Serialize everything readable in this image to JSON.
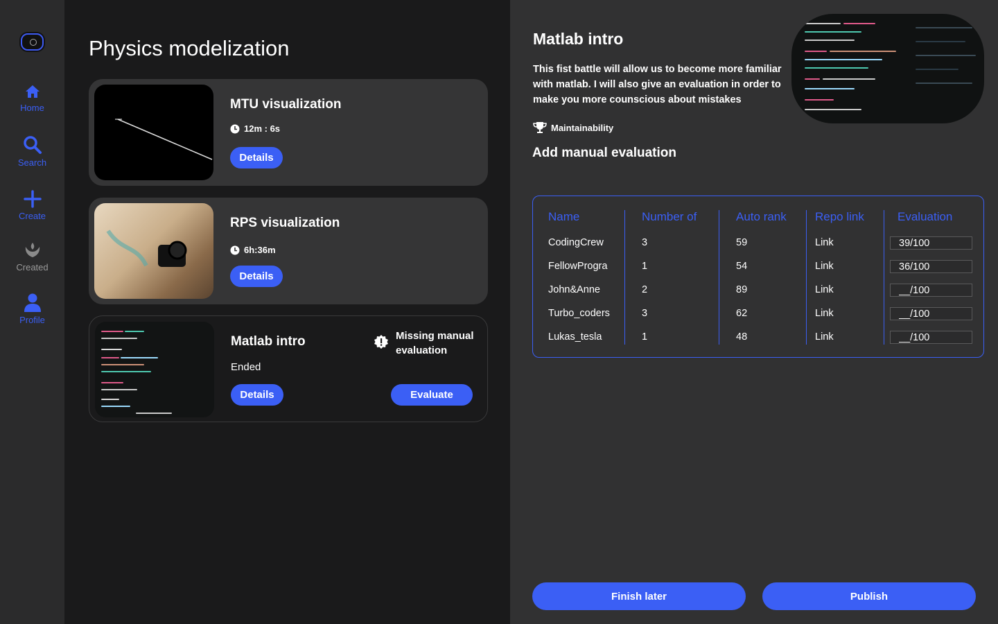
{
  "sidebar": {
    "logo": "app-logo",
    "items": [
      {
        "label": "Home",
        "icon": "home-icon"
      },
      {
        "label": "Search",
        "icon": "search-icon"
      },
      {
        "label": "Create",
        "icon": "plus-icon"
      },
      {
        "label": "Created",
        "icon": "emblem-icon"
      },
      {
        "label": "Profile",
        "icon": "user-icon"
      }
    ]
  },
  "main": {
    "title": "Physics modelization",
    "cards": [
      {
        "title": "MTU visualization",
        "meta": "12m : 6s",
        "details_label": "Details"
      },
      {
        "title": "RPS visualization",
        "meta": "6h:36m",
        "details_label": "Details"
      },
      {
        "title": "Matlab intro",
        "meta": "Ended",
        "details_label": "Details",
        "warning": "Missing manual evaluation",
        "evaluate_label": "Evaluate"
      }
    ]
  },
  "detail": {
    "title": "Matlab intro",
    "description": "This fist battle will allow us to become more familiar with matlab. I will also give an evaluation in order to make you more counscious about mistakes",
    "tag": "Maintainability",
    "subtitle": "Add manual evaluation",
    "table": {
      "headers": [
        "Name",
        "Number of",
        "Auto rank",
        "Repo link",
        "Evaluation"
      ],
      "rows": [
        {
          "name": "CodingCrew",
          "number": "3",
          "rank": "59",
          "link": "Link",
          "evaluation": "39/100"
        },
        {
          "name": "FellowProgra",
          "number": "1",
          "rank": "54",
          "link": "Link",
          "evaluation": "36/100"
        },
        {
          "name": "John&Anne",
          "number": "2",
          "rank": "89",
          "link": "Link",
          "evaluation": "__/100"
        },
        {
          "name": "Turbo_coders",
          "number": "3",
          "rank": "62",
          "link": "Link",
          "evaluation": "__/100"
        },
        {
          "name": "Lukas_tesla",
          "number": "1",
          "rank": "48",
          "link": "Link",
          "evaluation": "__/100"
        }
      ]
    },
    "finish_label": "Finish later",
    "publish_label": "Publish"
  },
  "colors": {
    "accent": "#3b5ff5",
    "background": "#1a1a1b",
    "panel": "#313132",
    "card": "#353536"
  }
}
